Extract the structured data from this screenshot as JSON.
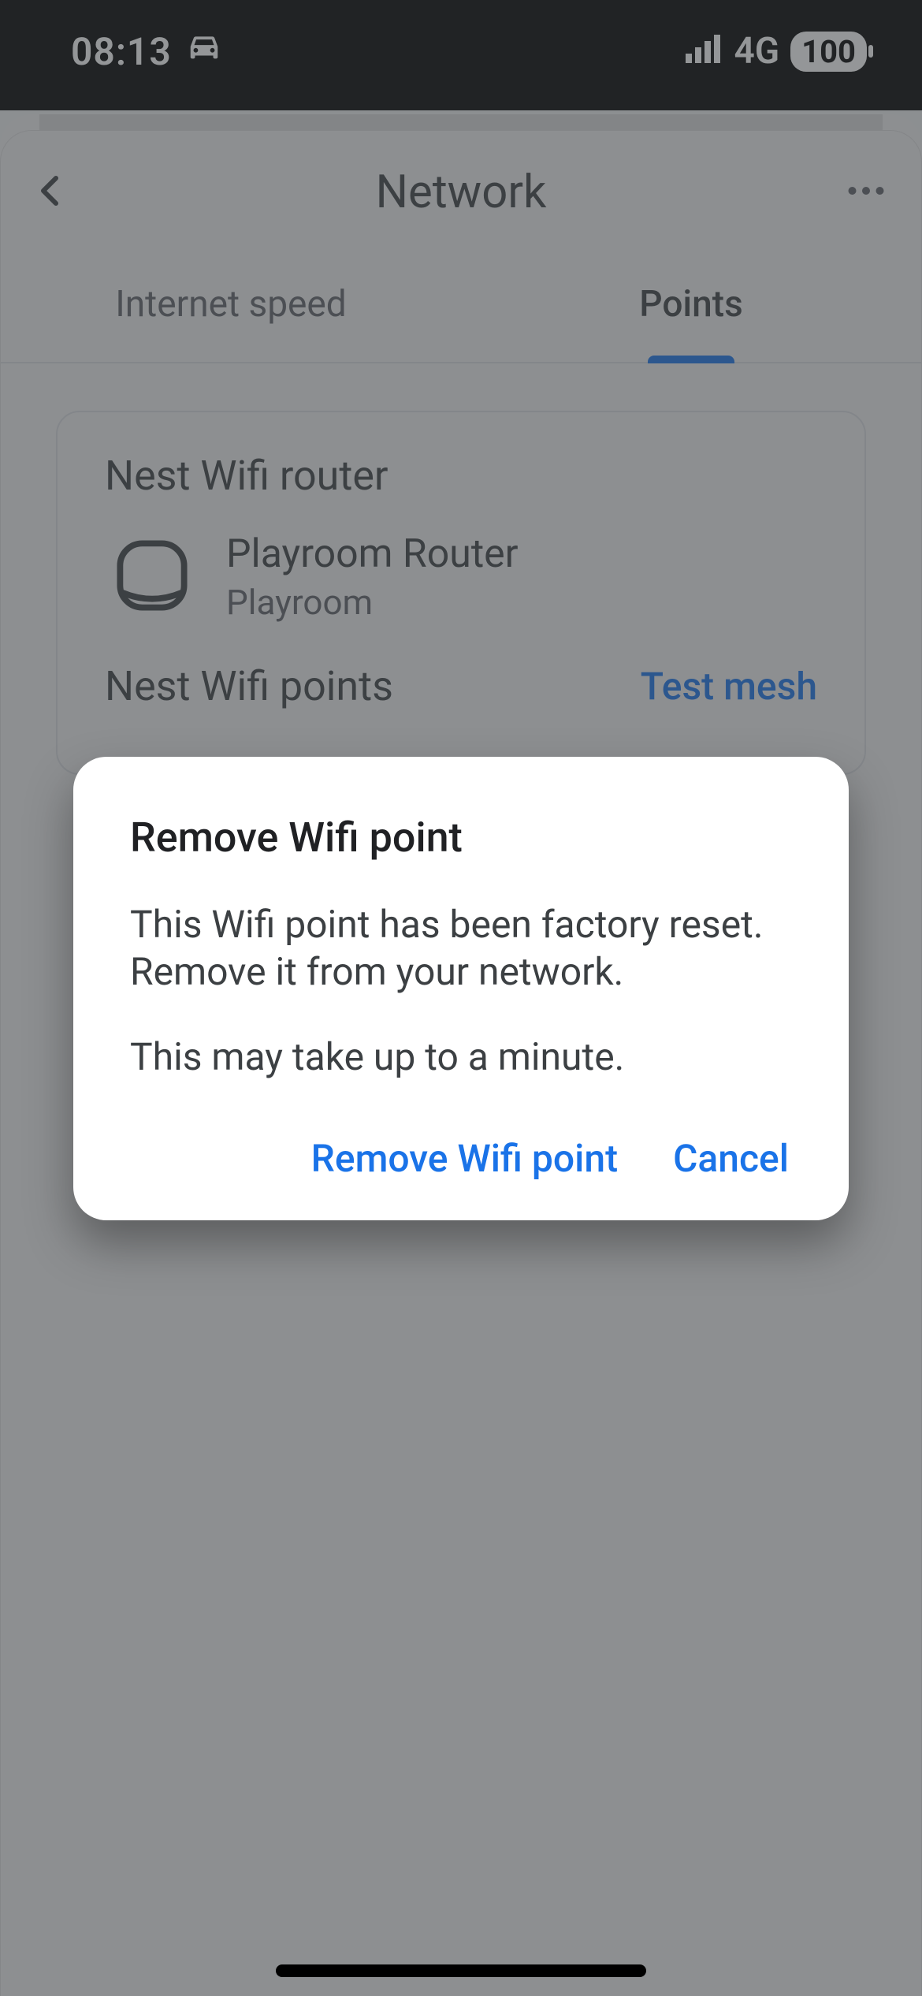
{
  "statusbar": {
    "time": "08:13",
    "driving_icon": "car-icon",
    "signal": "signal-4",
    "network_label": "4G",
    "battery_pct": "100"
  },
  "nav": {
    "title": "Network"
  },
  "tabs": {
    "speed": "Internet speed",
    "points": "Points"
  },
  "card": {
    "router_section": "Nest Wifi router",
    "router_name": "Playroom Router",
    "router_room": "Playroom",
    "points_section": "Nest Wifi points",
    "test_mesh": "Test mesh"
  },
  "dialog": {
    "title": "Remove Wifi point",
    "line1": "This Wifi point has been factory reset. Remove it from your network.",
    "line2": "This may take up to a minute.",
    "confirm": "Remove Wifi point",
    "cancel": "Cancel"
  }
}
